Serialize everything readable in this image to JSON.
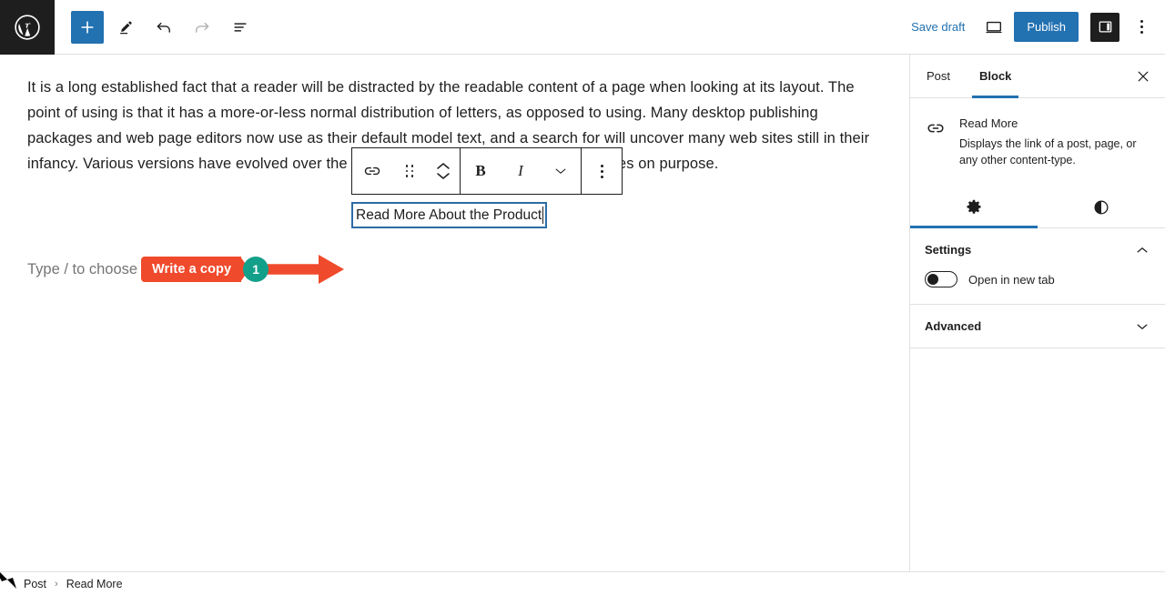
{
  "topbar": {
    "logo_icon": "wordpress-logo-icon",
    "tools": [
      {
        "name": "add-block-button",
        "icon": "plus-icon",
        "label": "Add block"
      },
      {
        "name": "tools-button",
        "icon": "pencil-icon",
        "label": "Tools"
      },
      {
        "name": "undo-button",
        "icon": "undo-icon",
        "label": "Undo"
      },
      {
        "name": "redo-button",
        "icon": "redo-icon",
        "label": "Redo"
      },
      {
        "name": "list-view-button",
        "icon": "list-view-icon",
        "label": "Document overview"
      }
    ],
    "save_draft_label": "Save draft",
    "preview_icon": "desktop-preview-icon",
    "publish_label": "Publish",
    "sidebar_toggle_icon": "sidebar-panel-icon",
    "more_options_icon": "three-dots-vertical-icon",
    "accent_blue": "#2271b1"
  },
  "editor": {
    "paragraph": "It is a long established fact that a reader will be distracted by the readable content of a page when looking at its layout. The point of using is that it has a more-or-less normal distribution of letters, as opposed to using. Many desktop publishing packages and web page editors now use as their default model text, and a search for will uncover many web sites still in their infancy. Various versions have evolved over the years, sometimes by accident, sometimes on purpose.",
    "empty_block_placeholder": "Type / to choose a block",
    "read_more_value": "Read More About the Product",
    "selection_border_color": "#2d6ca5"
  },
  "block_toolbar": {
    "buttons": [
      {
        "name": "link-button",
        "icon": "link-icon",
        "label": "Link"
      },
      {
        "name": "drag-handle",
        "icon": "drag-dots-icon",
        "label": "Drag"
      },
      {
        "name": "move-block-button",
        "icon": "up-down-chevrons-icon",
        "label": "Move up or down"
      },
      {
        "name": "bold-button",
        "icon": "bold-icon",
        "label": "B"
      },
      {
        "name": "italic-button",
        "icon": "italic-icon",
        "label": "I"
      },
      {
        "name": "more-rich-text-button",
        "icon": "chevron-down-icon",
        "label": "More"
      },
      {
        "name": "block-options-button",
        "icon": "three-dots-vertical-icon",
        "label": "Options"
      }
    ]
  },
  "annotation": {
    "label": "Write a copy",
    "step_number": "1",
    "label_color": "#f04a2c",
    "badge_color": "#12a08a",
    "arrow_color": "#f04a2c"
  },
  "sidebar": {
    "tabs": [
      {
        "label": "Post",
        "active": false
      },
      {
        "label": "Block",
        "active": true
      }
    ],
    "close_icon": "close-icon",
    "block_icon": "link-icon",
    "block_title": "Read More",
    "block_description": "Displays the link of a post, page, or any other content-type.",
    "icon_tabs": [
      {
        "name": "settings-tab",
        "icon": "gear-icon",
        "active": true
      },
      {
        "name": "styles-tab",
        "icon": "contrast-half-circle-icon",
        "active": false
      }
    ],
    "settings": {
      "title": "Settings",
      "chevron": "chevron-up-icon",
      "toggle_label": "Open in new tab",
      "toggle_on": false
    },
    "advanced": {
      "title": "Advanced",
      "chevron": "chevron-down-icon"
    }
  },
  "breadcrumb": {
    "items": [
      "Post",
      "Read More"
    ],
    "separator": "›"
  }
}
